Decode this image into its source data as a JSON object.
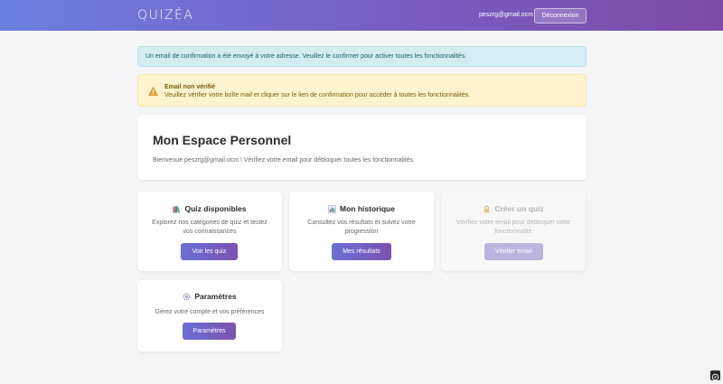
{
  "header": {
    "brand": "QUIZÉA",
    "user_email": "peszrg@gmail.ocm",
    "logout_label": "Déconnexion"
  },
  "alerts": {
    "info_text": "Un email de confirmation a été envoyé à votre adresse. Veuillez le confirmer pour activer toutes les fonctionnalités.",
    "warning_title": "Email non vérifié",
    "warning_text": "Veuillez vérifier votre boîte mail et cliquer sur le lien de confirmation pour accéder à toutes les fonctionnalités."
  },
  "welcome": {
    "title": "Mon Espace Personnel",
    "text": "Bienvenue peszrg@gmail.ocm ! Vérifiez votre email pour débloquer toutes les fonctionnalités."
  },
  "cards": {
    "quiz": {
      "icon": "books-icon",
      "title": "Quiz disponibles",
      "description": "Explorez nos catégories de quiz et testez vos connaissances",
      "button": "Voir les quiz"
    },
    "history": {
      "icon": "chart-icon",
      "title": "Mon historique",
      "description": "Consultez vos résultats et suivez votre progression",
      "button": "Mes résultats"
    },
    "create": {
      "icon": "lock-icon",
      "title": "Créer un quiz",
      "description": "Vérifiez votre email pour débloquer cette fonctionnalité",
      "button": "Vérifier email",
      "disabled": true
    },
    "settings": {
      "icon": "gear-icon",
      "title": "Paramètres",
      "description": "Gérez votre compte et vos préférences",
      "button": "Paramètres"
    }
  },
  "colors": {
    "header_gradient_start": "#6a7fe0",
    "header_gradient_end": "#7b4ba6",
    "button_gradient_start": "#6b6fd6",
    "button_gradient_end": "#7a52b0",
    "info_bg": "#d3ecf2",
    "warning_bg": "#fdf3cf"
  }
}
